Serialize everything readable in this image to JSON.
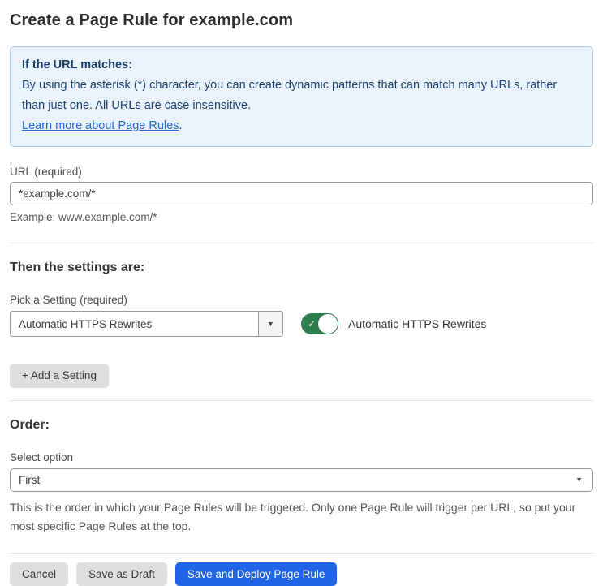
{
  "page": {
    "title": "Create a Page Rule for example.com"
  },
  "info_box": {
    "heading": "If the URL matches:",
    "body": "By using the asterisk (*) character, you can create dynamic patterns that can match many URLs, rather than just one. All URLs are case insensitive.",
    "link_label": "Learn more about Page Rules",
    "link_suffix": "."
  },
  "url_field": {
    "label": "URL (required)",
    "value": "*example.com/*",
    "helper": "Example: www.example.com/*"
  },
  "settings_section": {
    "heading": "Then the settings are:",
    "picker_label": "Pick a Setting (required)",
    "picker_value": "Automatic HTTPS Rewrites",
    "picker_arrow": "▼",
    "toggle_state": "on",
    "toggle_check": "✓",
    "toggle_label": "Automatic HTTPS Rewrites",
    "add_setting_label": "+ Add a Setting"
  },
  "order_section": {
    "heading": "Order:",
    "select_label": "Select option",
    "select_value": "First",
    "select_arrow": "▼",
    "helper": "This is the order in which your Page Rules will be triggered. Only one Page Rule will trigger per URL, so put your most specific Page Rules at the top."
  },
  "footer": {
    "cancel_label": "Cancel",
    "save_draft_label": "Save as Draft",
    "save_deploy_label": "Save and Deploy Page Rule"
  },
  "colors": {
    "info_bg": "#EAF3FC",
    "info_border": "#A9C9EA",
    "info_text": "#1D3F6E",
    "link_blue": "#2565DE",
    "toggle_green": "#2E7D4F",
    "primary_blue": "#2264E8",
    "button_gray": "#DFDFDF"
  }
}
